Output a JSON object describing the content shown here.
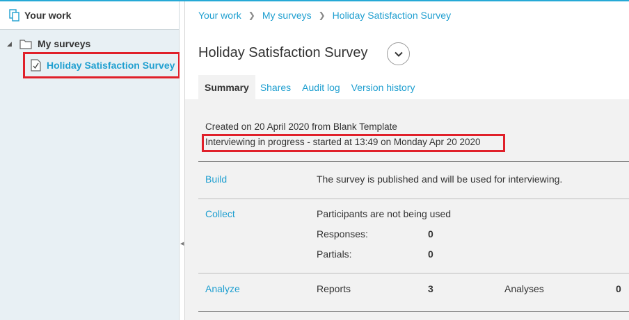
{
  "sidebar": {
    "header": "Your work",
    "folder": "My surveys",
    "selected_survey": "Holiday Satisfaction Survey"
  },
  "breadcrumb": [
    "Your work",
    "My surveys",
    "Holiday Satisfaction Survey"
  ],
  "title": "Holiday Satisfaction Survey",
  "tabs": [
    "Summary",
    "Shares",
    "Audit log",
    "Version history"
  ],
  "summary": {
    "created": "Created on 20 April 2020 from Blank Template",
    "status": "Interviewing in progress - started at 13:49 on Monday Apr 20 2020"
  },
  "sections": {
    "build": {
      "label": "Build",
      "text": "The survey is published and will be used for interviewing."
    },
    "collect": {
      "label": "Collect",
      "text": "Participants are not being used",
      "responses_label": "Responses:",
      "responses_value": "0",
      "partials_label": "Partials:",
      "partials_value": "0"
    },
    "analyze": {
      "label": "Analyze",
      "reports_label": "Reports",
      "reports_value": "3",
      "analyses_label": "Analyses",
      "analyses_value": "0"
    }
  },
  "colors": {
    "accent": "#1f9fd0",
    "highlight": "#e0202a",
    "sidebar_bg": "#e8f0f4",
    "panel_bg": "#f2f2f2"
  }
}
